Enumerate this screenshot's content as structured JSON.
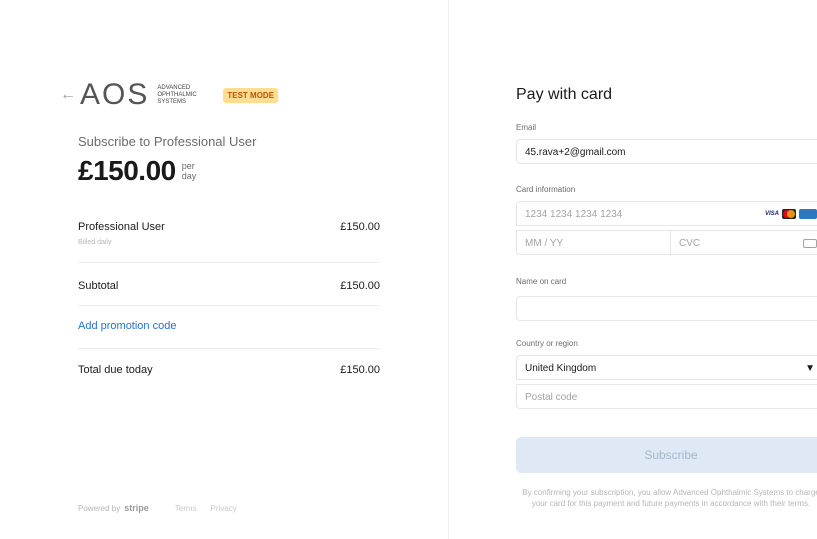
{
  "header": {
    "logo_text": "AOS",
    "logo_subtitle": "ADVANCED OPHTHALMIC SYSTEMS",
    "test_badge": "TEST MODE"
  },
  "summary": {
    "subscribe_line": "Subscribe to Professional User",
    "price": "£150.00",
    "period_prefix": "per",
    "period_unit": "day"
  },
  "line_items": [
    {
      "name": "Professional User",
      "sub": "Billed daily",
      "amount": "£150.00"
    }
  ],
  "subtotal": {
    "label": "Subtotal",
    "amount": "£150.00"
  },
  "promo_label": "Add promotion code",
  "total": {
    "label": "Total due today",
    "amount": "£150.00"
  },
  "footer": {
    "powered_by": "Powered by",
    "stripe": "stripe",
    "terms": "Terms",
    "privacy": "Privacy"
  },
  "form": {
    "title": "Pay with card",
    "email_label": "Email",
    "email_value": "45.rava+2@gmail.com",
    "card_label": "Card information",
    "card_number_placeholder": "1234 1234 1234 1234",
    "expiry_placeholder": "MM / YY",
    "cvc_placeholder": "CVC",
    "brands": [
      "VISA",
      "Mastercard",
      "Amex"
    ],
    "name_label": "Name on card",
    "name_value": "",
    "country_label": "Country or region",
    "country_value": "United Kingdom",
    "postal_placeholder": "Postal code",
    "subscribe_button": "Subscribe",
    "consent": "By confirming your subscription, you allow Advanced Ophthalmic Systems to charge your card for this payment and future payments in accordance with their terms."
  },
  "colors": {
    "accent_link": "#1f74d6",
    "badge_bg": "#ffde92",
    "badge_text": "#bb5504",
    "button_disabled_bg": "#dfe9f5"
  }
}
